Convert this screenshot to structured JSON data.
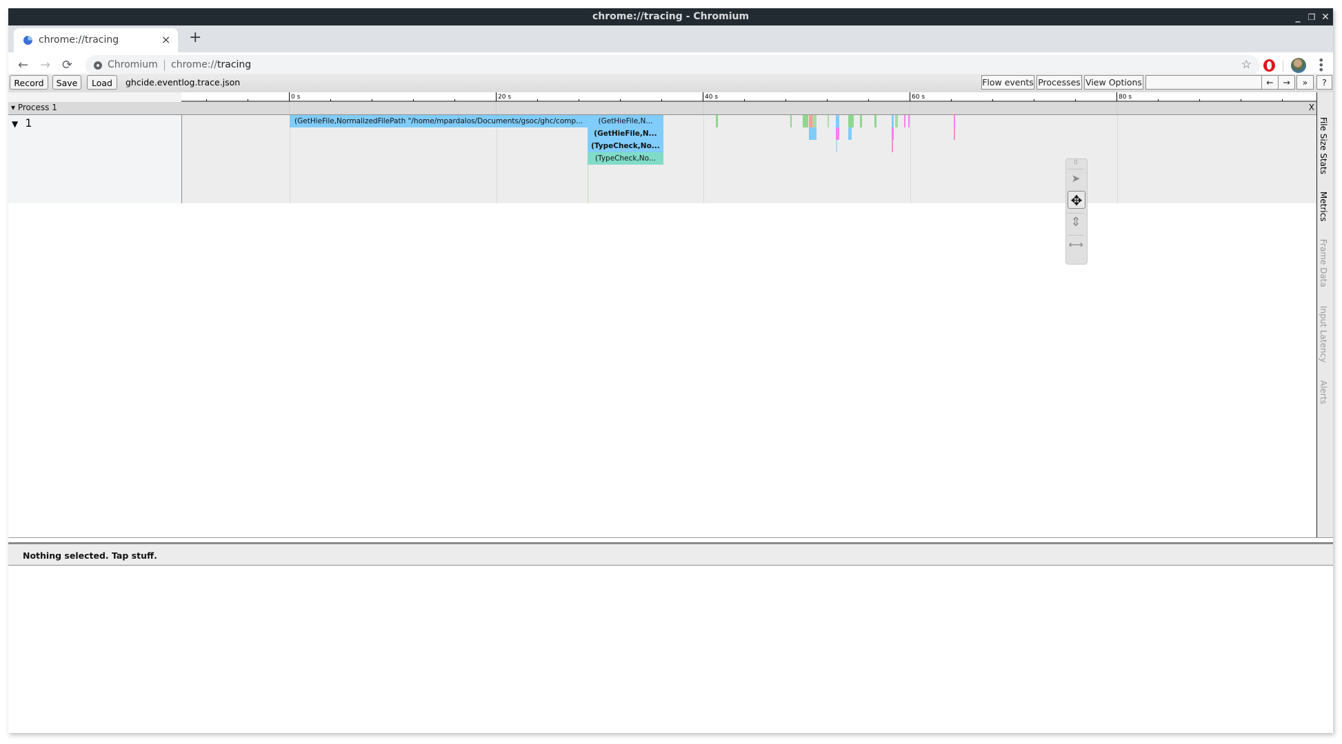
{
  "window": {
    "title": "chrome://tracing - Chromium"
  },
  "window_controls": {
    "minimize": "_",
    "restore": "❐",
    "close": "✕"
  },
  "tab": {
    "label": "chrome://tracing",
    "close": "×",
    "new_tab": "+"
  },
  "nav": {
    "back": "←",
    "forward": "→",
    "reload": "⟳"
  },
  "omnibox": {
    "origin": "Chromium",
    "url_prefix": "chrome://",
    "url_host": "tracing",
    "star": "☆"
  },
  "tracing_toolbar": {
    "record": "Record",
    "save": "Save",
    "load": "Load",
    "filename": "ghcide.eventlog.trace.json",
    "flow_events": "Flow events",
    "processes": "Processes",
    "view_options": "View Options",
    "search_value": "",
    "prev": "←",
    "next": "→",
    "more": "»",
    "help": "?"
  },
  "ruler": {
    "labels": [
      "0 s",
      "20 s",
      "40 s",
      "60 s",
      "80 s"
    ],
    "major_seconds": [
      0,
      20,
      40,
      60,
      80
    ],
    "minor_step_seconds": 4,
    "start_seconds": -10.4,
    "end_seconds": 99.3
  },
  "process": {
    "label": "Process 1",
    "close": "X",
    "expander": "▾"
  },
  "thread": {
    "label": "1",
    "expander": "▼"
  },
  "slices": [
    {
      "row": 0,
      "start": 0.0,
      "end": 28.8,
      "color": "#80ccfa",
      "title": "(GetHieFile,NormalizedFilePath \"/home/mpardalos/Documents/gsoc/ghc/comp..."
    },
    {
      "row": 0,
      "start": 28.8,
      "end": 36.1,
      "color": "#80ccfa",
      "title": "(GetHieFile,N..."
    },
    {
      "row": 1,
      "start": 28.8,
      "end": 36.1,
      "color": "#80ccfa",
      "title": "(GetHieFile,N...",
      "bold": true
    },
    {
      "row": 2,
      "start": 28.8,
      "end": 36.1,
      "color": "#80ccfa",
      "title": "(TypeCheck,No...",
      "bold": true
    },
    {
      "row": 3,
      "start": 28.8,
      "end": 36.1,
      "color": "#80dcc8",
      "title": "(TypeCheck,No..."
    },
    {
      "row": 0,
      "start": 41.2,
      "end": 41.4,
      "color": "#8fd68f",
      "title": ""
    },
    {
      "row": 0,
      "start": 48.4,
      "end": 48.5,
      "color": "#8fd68f",
      "title": ""
    },
    {
      "row": 0,
      "start": 49.6,
      "end": 50.1,
      "color": "#8fd68f",
      "title": ""
    },
    {
      "row": 0,
      "start": 50.2,
      "end": 50.5,
      "color": "#ff9b9b",
      "title": ""
    },
    {
      "row": 1,
      "start": 50.2,
      "end": 50.9,
      "color": "#80ccfa",
      "title": ""
    },
    {
      "row": 0,
      "start": 50.5,
      "end": 50.9,
      "color": "#a6dca6",
      "title": ""
    },
    {
      "row": 0,
      "start": 52.0,
      "end": 52.1,
      "color": "#a6dca6",
      "title": ""
    },
    {
      "row": 0,
      "start": 52.8,
      "end": 53.1,
      "color": "#80ccfa",
      "title": ""
    },
    {
      "row": 1,
      "start": 52.8,
      "end": 53.1,
      "color": "#f77ff0",
      "title": ""
    },
    {
      "row": 2,
      "start": 52.8,
      "end": 52.9,
      "color": "#b8d6f0",
      "title": ""
    },
    {
      "row": 0,
      "start": 54.0,
      "end": 54.5,
      "color": "#8fd68f",
      "title": ""
    },
    {
      "row": 1,
      "start": 54.0,
      "end": 54.3,
      "color": "#80ccfa",
      "title": ""
    },
    {
      "row": 0,
      "start": 55.1,
      "end": 55.3,
      "color": "#8fd68f",
      "title": ""
    },
    {
      "row": 0,
      "start": 56.5,
      "end": 56.7,
      "color": "#8fd68f",
      "title": ""
    },
    {
      "row": 0,
      "start": 58.2,
      "end": 58.4,
      "color": "#80ccfa",
      "title": ""
    },
    {
      "row": 1,
      "start": 58.2,
      "end": 58.4,
      "color": "#f77ff0",
      "title": ""
    },
    {
      "row": 2,
      "start": 58.2,
      "end": 58.3,
      "color": "#f790c8",
      "title": ""
    },
    {
      "row": 0,
      "start": 58.5,
      "end": 58.8,
      "color": "#a6dca6",
      "title": ""
    },
    {
      "row": 0,
      "start": 59.4,
      "end": 59.5,
      "color": "#f77ff0",
      "title": ""
    },
    {
      "row": 0,
      "start": 59.8,
      "end": 59.9,
      "color": "#f77ff0",
      "title": ""
    },
    {
      "row": 0,
      "start": 64.2,
      "end": 64.3,
      "color": "#f77ff0",
      "title": ""
    },
    {
      "row": 1,
      "start": 64.2,
      "end": 64.3,
      "color": "#f790c8",
      "title": ""
    }
  ],
  "mode_selector": {
    "drag": "⠿",
    "select": "➤",
    "pan": "✥",
    "zoom": "⇕",
    "timing": "⟷"
  },
  "side_tabs": [
    {
      "label": "File Size Stats",
      "active": true
    },
    {
      "label": "Metrics",
      "active": true
    },
    {
      "label": "Frame Data",
      "active": false
    },
    {
      "label": "Input Latency",
      "active": false
    },
    {
      "label": "Alerts",
      "active": false
    }
  ],
  "analysis": {
    "message": "Nothing selected. Tap stuff."
  }
}
